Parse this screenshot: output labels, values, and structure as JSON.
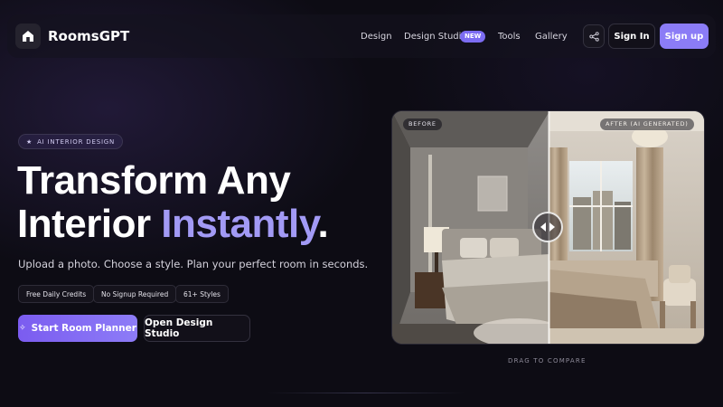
{
  "nav": {
    "brand": "RoomsGPT",
    "links": [
      {
        "label": "Design"
      },
      {
        "label": "Design Studio",
        "badge": "NEW"
      },
      {
        "label": "Tools"
      },
      {
        "label": "Gallery"
      }
    ],
    "share_icon": "share-icon",
    "signin_label": "Sign In",
    "signup_label": "Sign up"
  },
  "hero": {
    "tag": "AI INTERIOR DESIGN",
    "title_line1": "Transform Any",
    "title_line2_plain": "Interior ",
    "title_line2_accent": "Instantly",
    "title_line2_end": ".",
    "subtitle": "Upload a photo. Choose a style. Plan your perfect room in seconds.",
    "chips": [
      "Free Daily Credits",
      "No Signup Required",
      "61+ Styles"
    ],
    "cta_primary": "Start Room Planner",
    "cta_secondary": "Open Design Studio"
  },
  "compare": {
    "before_label": "BEFORE",
    "after_label": "AFTER (AI GENERATED)",
    "caption": "DRAG TO COMPARE",
    "split_fraction": 0.5
  },
  "colors": {
    "accent": "#a29af5",
    "primary_button": "#8b7cf6",
    "background": "#0d0c14"
  }
}
